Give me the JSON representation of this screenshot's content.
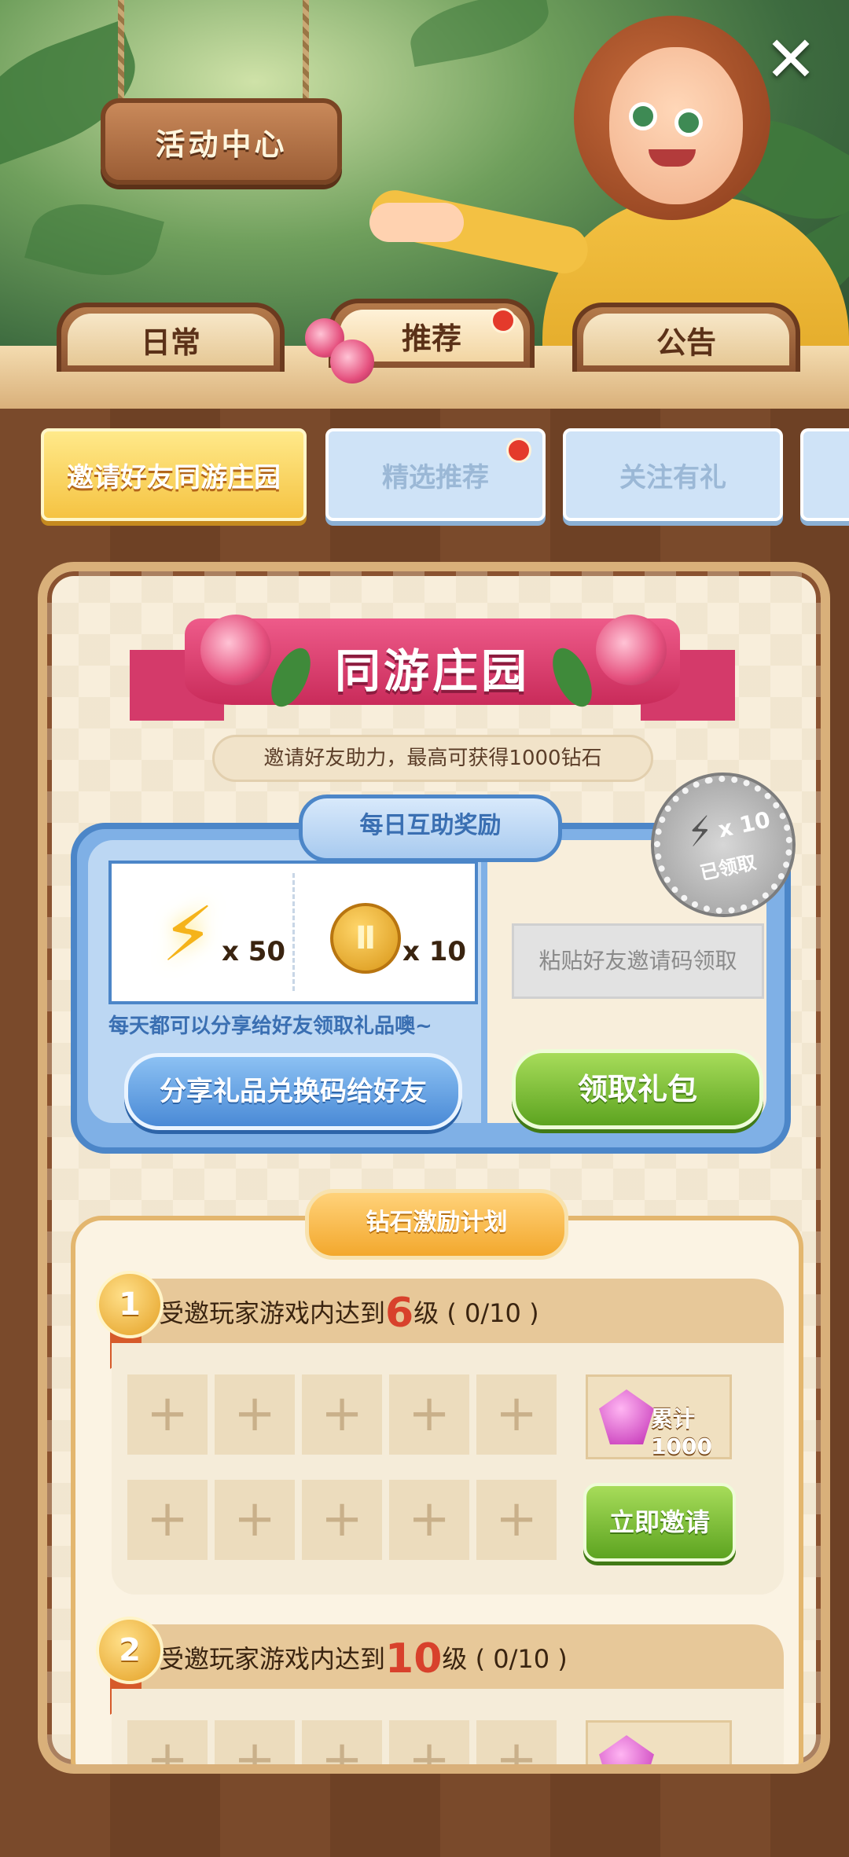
{
  "header": {
    "sign_title": "活动中心",
    "close_label": "✕"
  },
  "main_tabs": [
    {
      "label": "日常",
      "active": false
    },
    {
      "label": "推荐",
      "active": true,
      "has_dot": true
    },
    {
      "label": "公告",
      "active": false
    }
  ],
  "sub_tabs": [
    {
      "label": "邀请好友同游庄园",
      "active": true
    },
    {
      "label": "精选推荐",
      "active": false,
      "has_dot": true
    },
    {
      "label": "关注有礼",
      "active": false
    }
  ],
  "event": {
    "title": "同游庄园",
    "subtitle": "邀请好友助力，最高可获得1000钻石"
  },
  "daily": {
    "header": "每日互助奖励",
    "rewards": [
      {
        "icon": "lightning-icon",
        "qty": "x 50"
      },
      {
        "icon": "coin-icon",
        "qty": "x 10"
      }
    ],
    "tip": "每天都可以分享给好友领取礼品噢~",
    "share_button": "分享礼品兑换码给好友",
    "code_placeholder": "粘贴好友邀请码领取",
    "claim_button": "领取礼包",
    "stamp": {
      "qty": "x 10",
      "label": "已领取"
    }
  },
  "plan": {
    "header": "钻石激励计划",
    "tiers": [
      {
        "number": "1",
        "prefix": "受邀玩家游戏内达到",
        "level": "6",
        "suffix": "级 ( 0/10 )",
        "reward": "累计1000",
        "button": "立即邀请"
      },
      {
        "number": "2",
        "prefix": "受邀玩家游戏内达到",
        "level": "10",
        "suffix": "级 ( 0/10 )"
      }
    ]
  },
  "colors": {
    "wood": "#6a4026",
    "accent_blue": "#4c86c8",
    "accent_green": "#5da420",
    "accent_pink": "#d43a6a",
    "level_red": "#d8412c"
  }
}
